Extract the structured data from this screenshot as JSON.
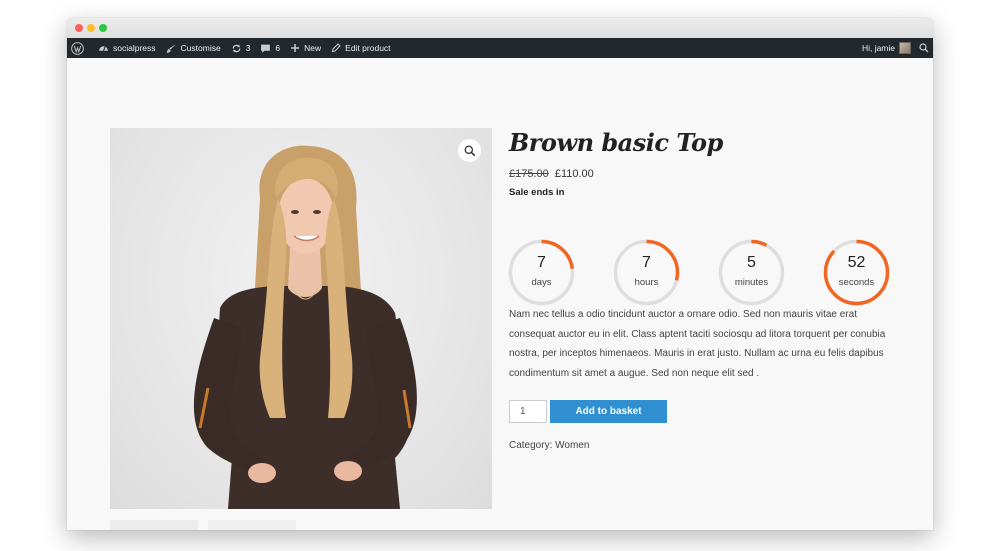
{
  "adminbar": {
    "site_name": "socialpress",
    "customise": "Customise",
    "updates_count": "3",
    "comments_count": "6",
    "new_label": "New",
    "edit_product": "Edit product",
    "greeting": "Hi, jamie"
  },
  "product": {
    "title": "Brown basic Top",
    "old_price": "£175.00",
    "new_price": "£110.00",
    "sale_label": "Sale ends in",
    "description": "Nam nec tellus a odio tincidunt auctor a ornare odio. Sed non mauris vitae erat consequat auctor eu in elit. Class aptent taciti sociosqu ad litora torquent per conubia nostra, per inceptos himenaeos. Mauris in erat justo. Nullam ac urna eu felis dapibus condimentum sit amet a augue. Sed non neque elit sed .",
    "quantity": "1",
    "add_to_basket": "Add to basket",
    "category_label": "Category:",
    "category_value": "Women"
  },
  "countdown": [
    {
      "value": "7",
      "label": "days",
      "fraction": 0.23
    },
    {
      "value": "7",
      "label": "hours",
      "fraction": 0.29
    },
    {
      "value": "5",
      "label": "minutes",
      "fraction": 0.08
    },
    {
      "value": "52",
      "label": "seconds",
      "fraction": 0.87
    }
  ],
  "colors": {
    "accent": "#f26522",
    "ring_track": "#dedede",
    "button": "#2f8fd1",
    "adminbar": "#23282d"
  }
}
